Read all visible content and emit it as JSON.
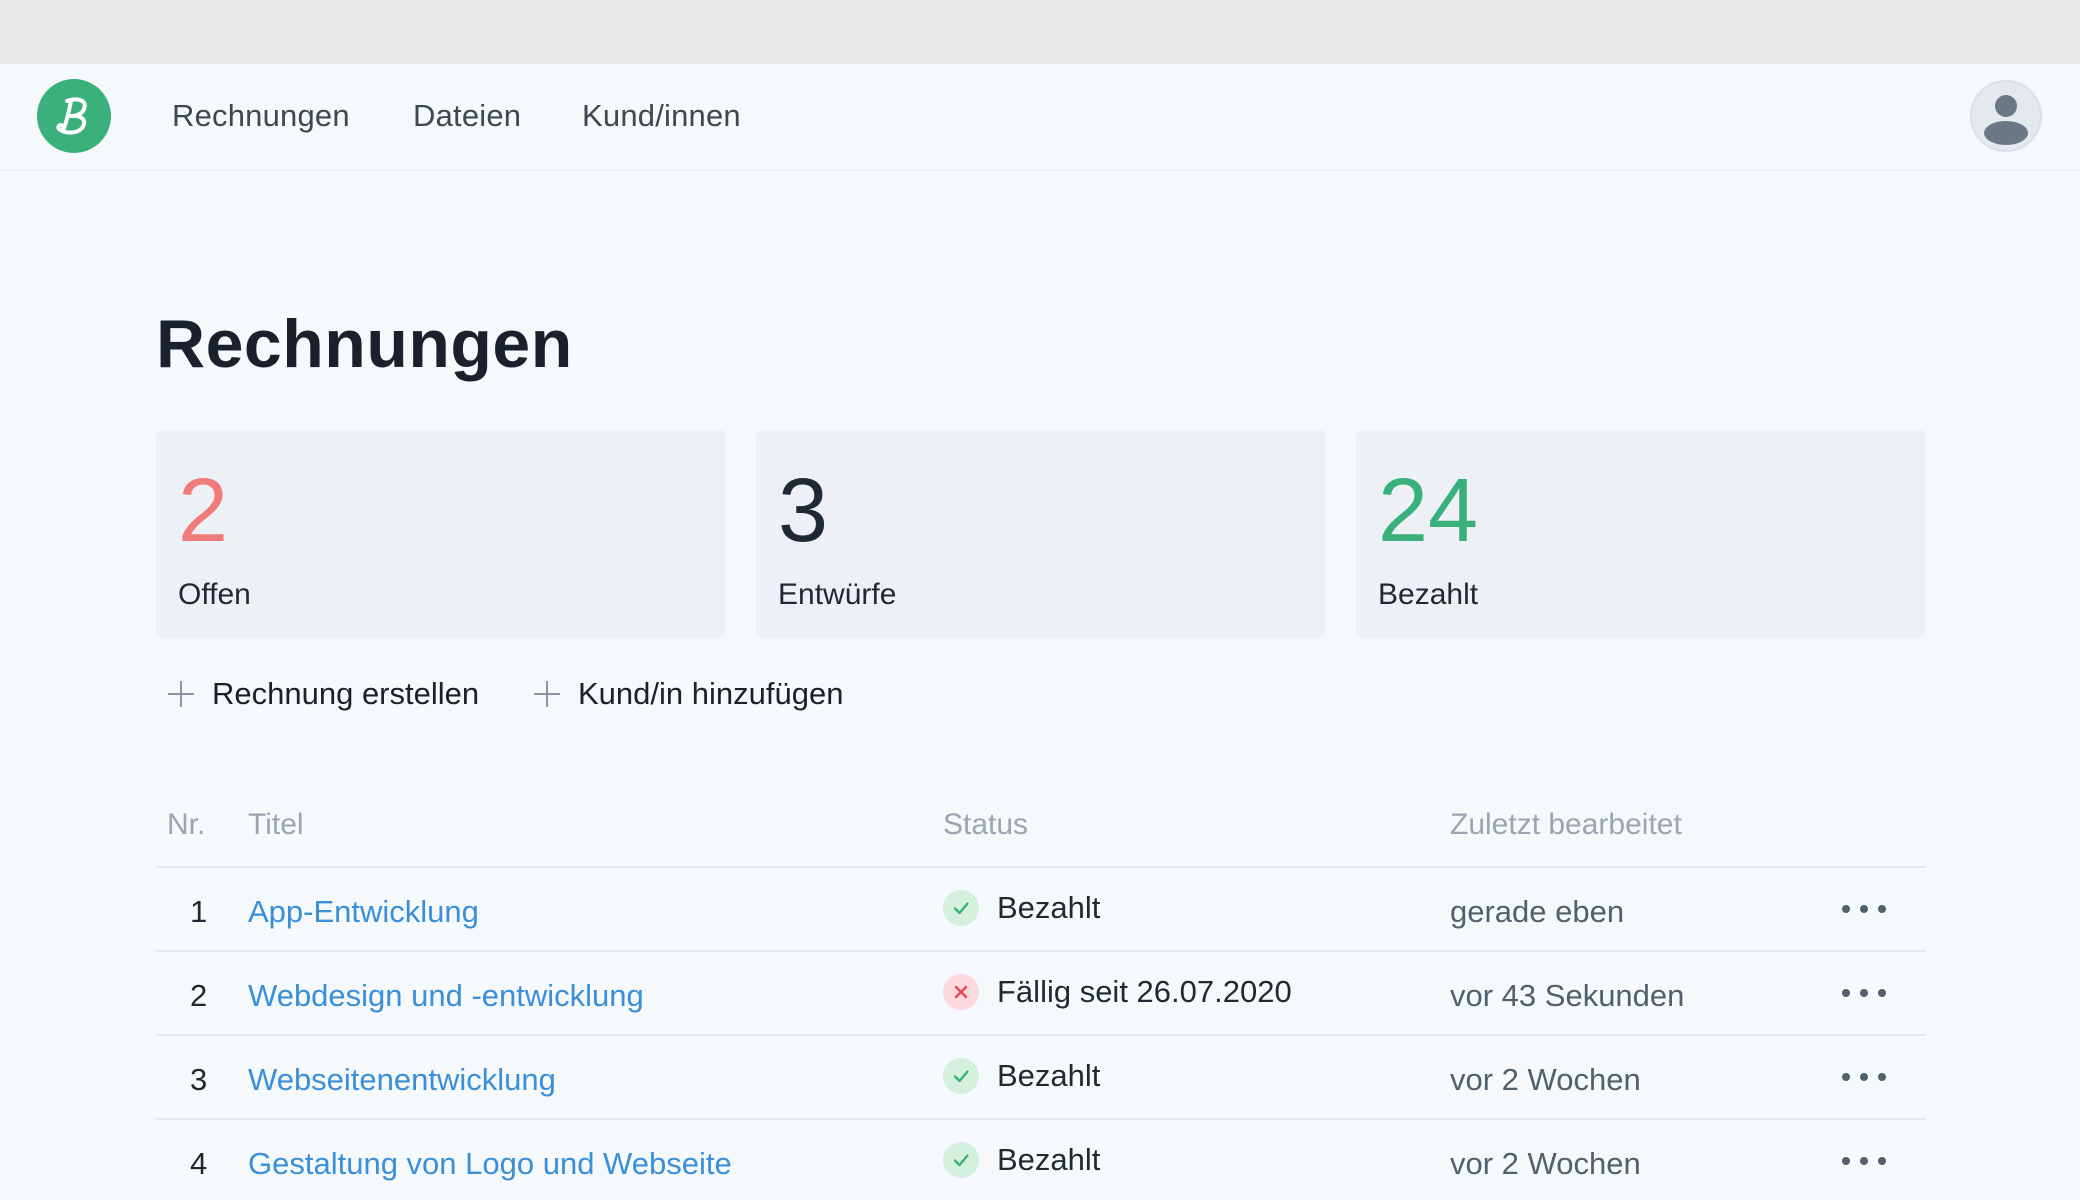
{
  "colors": {
    "brand": "#3ab07b",
    "open": "#f07b7b",
    "drafts": "#1f2933",
    "paid": "#3ab07b",
    "link": "#3a8fd8"
  },
  "nav": {
    "logo_icon": "brand-b-logo",
    "links": [
      "Rechnungen",
      "Dateien",
      "Kund/innen"
    ],
    "avatar_icon": "user-avatar-icon"
  },
  "page": {
    "title": "Rechnungen"
  },
  "stats": [
    {
      "value": "2",
      "label": "Offen"
    },
    {
      "value": "3",
      "label": "Entwürfe"
    },
    {
      "value": "24",
      "label": "Bezahlt"
    }
  ],
  "actions": {
    "create_invoice": "Rechnung erstellen",
    "add_customer": "Kund/in hinzufügen"
  },
  "table": {
    "headers": {
      "nr": "Nr.",
      "title": "Titel",
      "status": "Status",
      "edited": "Zuletzt bearbeitet"
    },
    "rows": [
      {
        "nr": "1",
        "title": "App-Entwicklung",
        "status": "Bezahlt",
        "status_type": "paid",
        "edited": "gerade eben"
      },
      {
        "nr": "2",
        "title": "Webdesign und -entwicklung",
        "status": "Fällig seit 26.07.2020",
        "status_type": "overdue",
        "edited": "vor 43 Sekunden"
      },
      {
        "nr": "3",
        "title": "Webseitenentwicklung",
        "status": "Bezahlt",
        "status_type": "paid",
        "edited": "vor 2 Wochen"
      },
      {
        "nr": "4",
        "title": "Gestaltung von Logo und Webseite",
        "status": "Bezahlt",
        "status_type": "paid",
        "edited": "vor 2 Wochen"
      }
    ]
  }
}
